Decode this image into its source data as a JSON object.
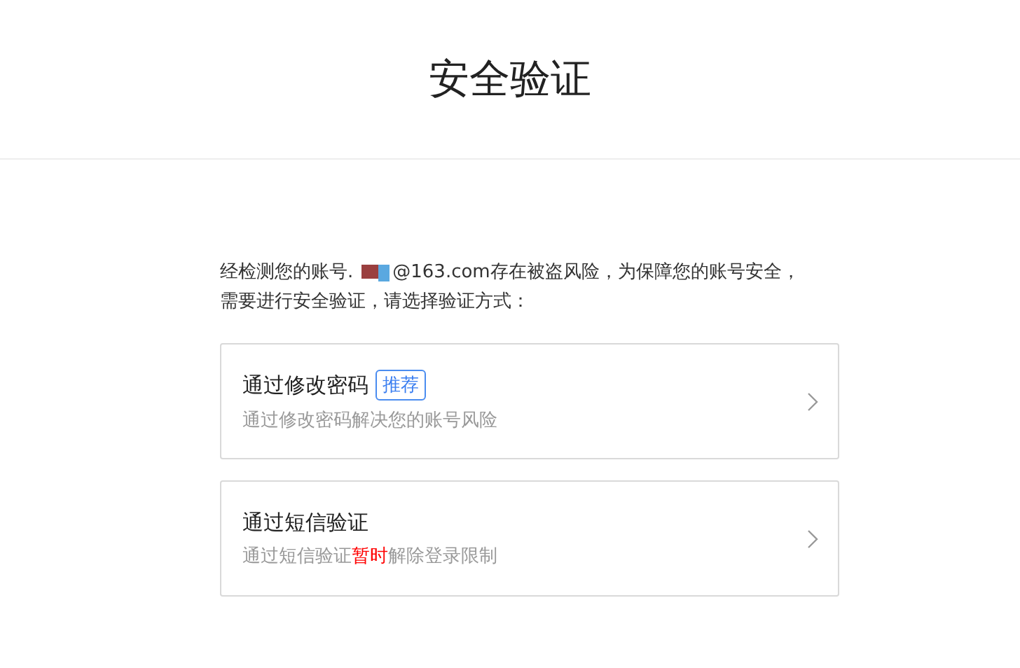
{
  "header": {
    "title": "安全验证"
  },
  "notice": {
    "before": "经检测您的账号.",
    "redacted": true,
    "after": "@163.com存在被盗风险，为保障您的账号安全，",
    "continuation": "需要进行安全验证，请选择验证方式："
  },
  "options": [
    {
      "title": "通过修改密码",
      "badge": "推荐",
      "description": [
        {
          "text": "通过修改密码解决您的账号风险",
          "highlight": false
        }
      ]
    },
    {
      "title": "通过短信验证",
      "description": [
        {
          "text": "通过短信验证",
          "highlight": false
        },
        {
          "text": "暂时",
          "highlight": true
        },
        {
          "text": "解除登录限制",
          "highlight": false
        }
      ]
    }
  ]
}
